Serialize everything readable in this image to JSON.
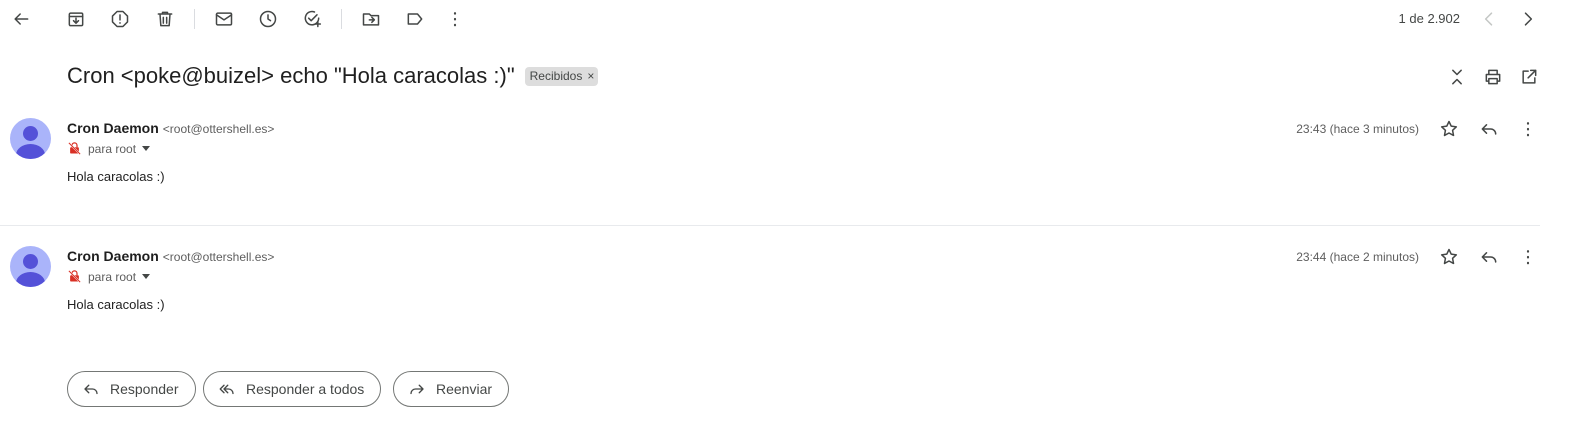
{
  "toolbar": {
    "icons": [
      "back-arrow-icon",
      "archive-icon",
      "report-spam-icon",
      "delete-icon",
      "mark-unread-icon",
      "snooze-icon",
      "add-to-tasks-icon",
      "move-to-icon",
      "label-icon",
      "more-vert-icon"
    ],
    "counter": "1 de 2.902"
  },
  "subject": {
    "title": "Cron <poke@buizel> echo \"Hola caracolas :)\"",
    "label": "Recibidos",
    "label_close": "×"
  },
  "messages": [
    {
      "sender_name": "Cron Daemon",
      "sender_addr": "<root@ottershell.es>",
      "to": "para root",
      "time": "23:43 (hace 3 minutos)",
      "body": "Hola caracolas :)"
    },
    {
      "sender_name": "Cron Daemon",
      "sender_addr": "<root@ottershell.es>",
      "to": "para root",
      "time": "23:44 (hace 2 minutos)",
      "body": "Hola caracolas :)"
    }
  ],
  "actions": {
    "reply": "Responder",
    "reply_all": "Responder a todos",
    "forward": "Reenviar"
  },
  "colors": {
    "avatar_bg": "#aab4fa",
    "avatar_fg": "#5451d8",
    "unencrypted_icon": "#d93025"
  }
}
